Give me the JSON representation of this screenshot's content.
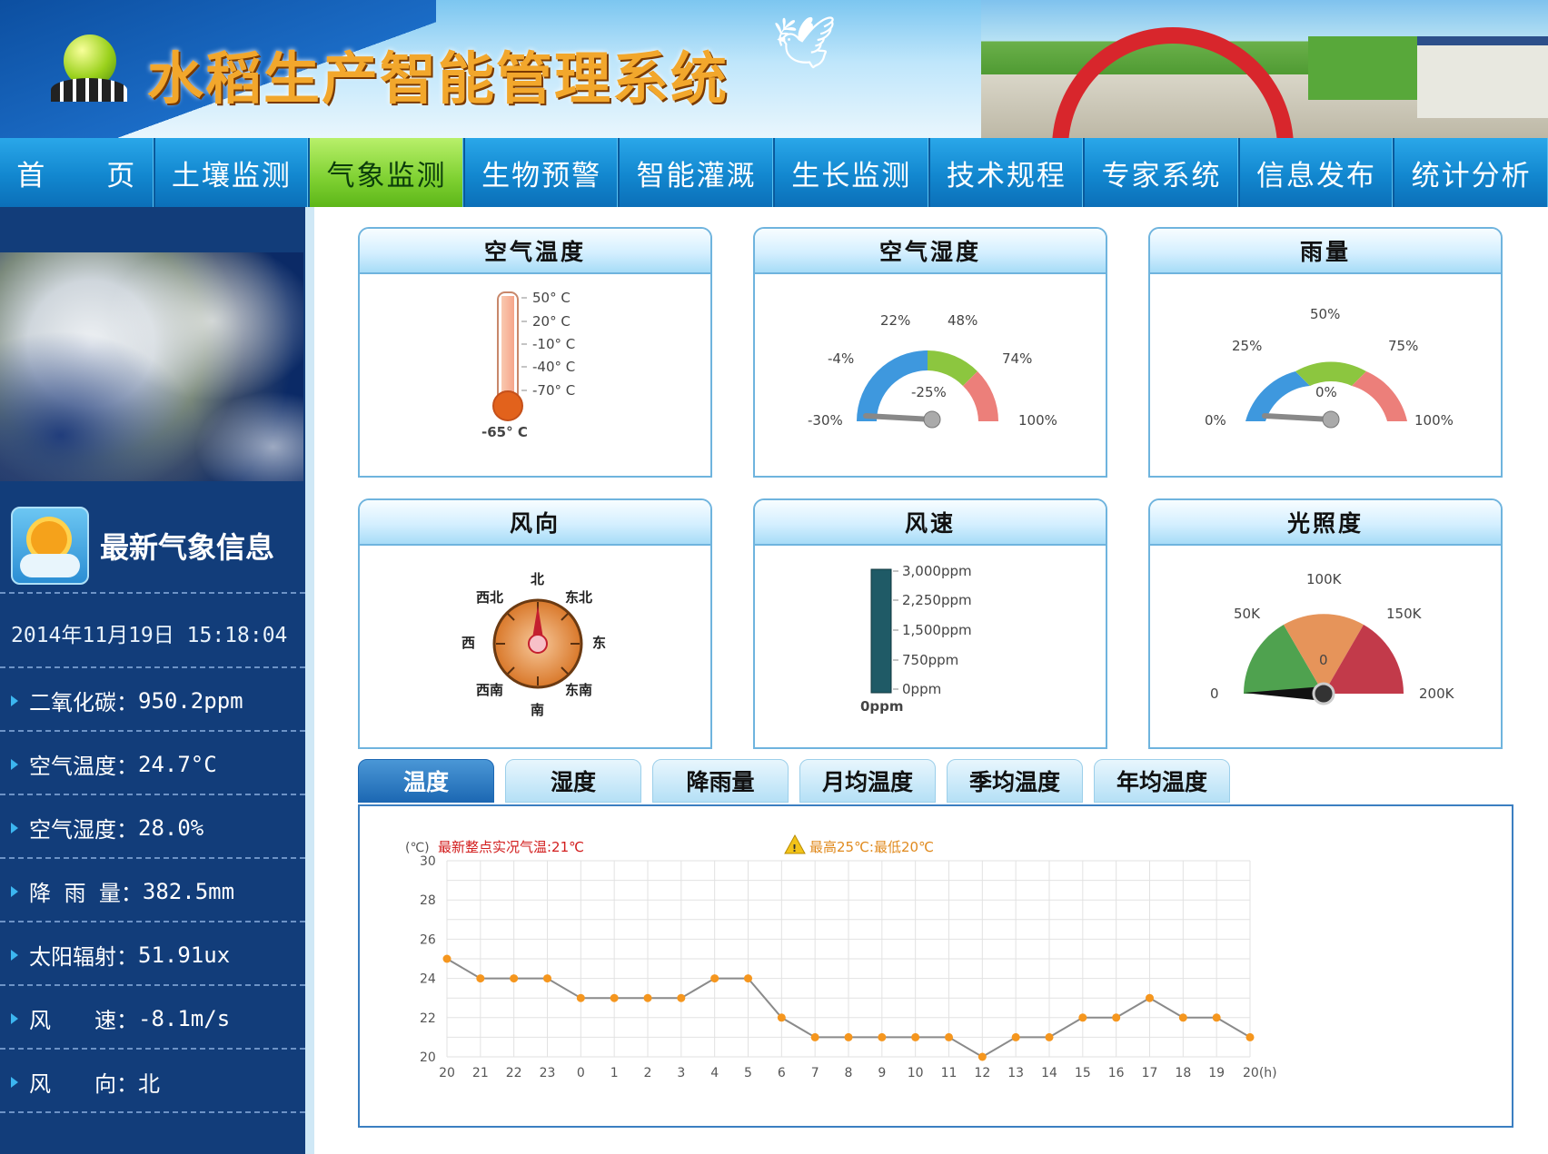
{
  "header": {
    "title": "水稻生产智能管理系统"
  },
  "nav": {
    "items": [
      "首　　页",
      "土壤监测",
      "气象监测",
      "生物预警",
      "智能灌溉",
      "生长监测",
      "技术规程",
      "专家系统",
      "信息发布",
      "统计分析"
    ],
    "active_index": 2
  },
  "sidebar": {
    "info_title": "最新气象信息",
    "datetime": "2014年11月19日 15:18:04",
    "rows": [
      {
        "label": "二氧化碳：",
        "value": "950.2ppm"
      },
      {
        "label": "空气温度：",
        "value": "24.7°C"
      },
      {
        "label": "空气湿度：",
        "value": "28.0%"
      },
      {
        "label": "降 雨 量：",
        "value": "382.5mm"
      },
      {
        "label": "太阳辐射：",
        "value": "51.91ux"
      },
      {
        "label": "风　　速：",
        "value": "-8.1m/s"
      },
      {
        "label": "风　　向：",
        "value": "北"
      }
    ]
  },
  "panels": {
    "air_temp": {
      "title": "空气温度",
      "ticks": [
        "50° C",
        "20° C",
        "-10° C",
        "-40° C",
        "-70° C"
      ],
      "reading": "-65° C"
    },
    "air_humidity": {
      "title": "空气湿度",
      "ticks": [
        "-30%",
        "-4%",
        "22%",
        "48%",
        "74%",
        "100%"
      ],
      "center": "-25%"
    },
    "rain": {
      "title": "雨量",
      "ticks": [
        "0%",
        "25%",
        "50%",
        "75%",
        "100%"
      ],
      "center": "0%"
    },
    "wind_dir": {
      "title": "风向",
      "labels": [
        "北",
        "东北",
        "东",
        "东南",
        "南",
        "西南",
        "西",
        "西北"
      ]
    },
    "wind_speed": {
      "title": "风速",
      "ticks": [
        "3,000ppm",
        "2,250ppm",
        "1,500ppm",
        "750ppm",
        "0ppm"
      ],
      "reading": "0ppm"
    },
    "light": {
      "title": "光照度",
      "ticks": [
        "0",
        "50K",
        "100K",
        "150K",
        "200K"
      ],
      "center": "0"
    }
  },
  "tabs": {
    "items": [
      "温度",
      "湿度",
      "降雨量",
      "月均温度",
      "季均温度",
      "年均温度"
    ],
    "active_index": 0
  },
  "chart_data": {
    "type": "line",
    "unit_label": "(℃)",
    "annotation_latest": "最新整点实况气温:21℃",
    "annotation_range": "最高25℃:最低20℃",
    "x": [
      "20",
      "21",
      "22",
      "23",
      "0",
      "1",
      "2",
      "3",
      "4",
      "5",
      "6",
      "7",
      "8",
      "9",
      "10",
      "11",
      "12",
      "13",
      "14",
      "15",
      "16",
      "17",
      "18",
      "19",
      "20(h)"
    ],
    "y": [
      25,
      24,
      24,
      24,
      23,
      23,
      23,
      23,
      24,
      24,
      22,
      21,
      21,
      21,
      21,
      21,
      20,
      21,
      21,
      22,
      22,
      23,
      22,
      22,
      21
    ],
    "ylim": [
      20,
      30
    ],
    "yticks": [
      20,
      22,
      24,
      26,
      28,
      30
    ],
    "grid": true,
    "colors": {
      "line": "#8a8a8a",
      "marker": "#f5961e",
      "latest": "#d21d1d",
      "range": "#e08a1e"
    }
  }
}
